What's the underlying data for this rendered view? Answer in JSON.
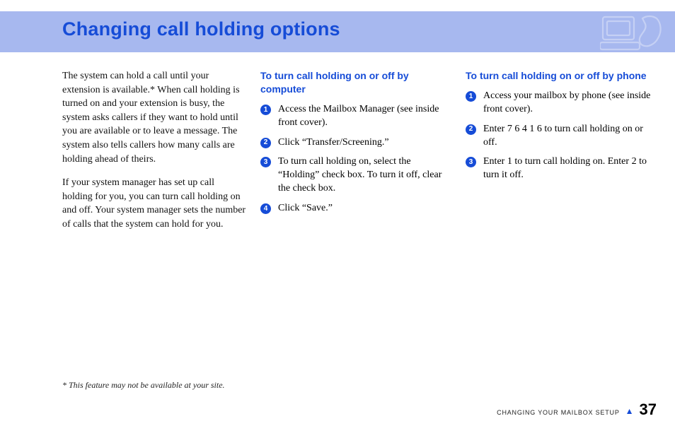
{
  "title": "Changing call holding options",
  "intro": {
    "p1": "The system can hold a call until your extension is available.* When call holding is turned on and your extension is busy, the system asks callers if they want to hold until you are available or to leave a message. The system also tells callers how many calls are holding ahead of theirs.",
    "p2": "If your system manager has set up call holding for you, you can turn call holding on and off. Your system manager sets the number of calls that the system can hold for you."
  },
  "procs": [
    {
      "heading": "To turn call holding on or off by computer",
      "steps": [
        "Access the Mailbox Manager (see inside front cover).",
        "Click “Transfer/Screening.”",
        "To turn call holding on, select the “Holding” check box. To turn it off, clear the check box.",
        "Click “Save.”"
      ]
    },
    {
      "heading": "To turn call holding on or off by phone",
      "steps": [
        "Access your mailbox by phone (see inside front cover).",
        "Enter 7 6 4 1 6 to turn call holding on or off.",
        "Enter 1 to turn call holding on. Enter 2 to turn it off."
      ]
    }
  ],
  "footnote": "* This feature may not be available at your site.",
  "footer": {
    "section": "CHANGING YOUR MAILBOX SETUP",
    "page": "37"
  }
}
